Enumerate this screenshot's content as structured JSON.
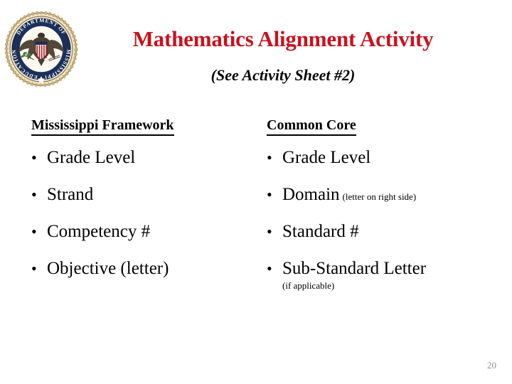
{
  "slide": {
    "title": "Mathematics Alignment Activity",
    "title_color": "#C9121C",
    "subtitle": "(See Activity Sheet #2)",
    "page_number": "20",
    "background_color": "#FFFFFF"
  },
  "logo": {
    "name": "mississippi-department-of-education-seal",
    "ring_text_top": "DEPARTMENT OF",
    "ring_text_bottom": "MISSISSIPPI EDUCATION",
    "ring_color": "#1B2F59",
    "rope_color": "#C9B07A",
    "shield_color": "#B02028"
  },
  "columns": [
    {
      "id": "mississippi-framework",
      "heading": "Mississippi Framework",
      "items": [
        {
          "text": "Grade Level",
          "note": "",
          "note_position": "none"
        },
        {
          "text": "Strand",
          "note": "",
          "note_position": "none"
        },
        {
          "text": "Competency #",
          "note": "",
          "note_position": "none"
        },
        {
          "text": "Objective (letter)",
          "note": "",
          "note_position": "none"
        }
      ]
    },
    {
      "id": "common-core",
      "heading": "Common Core",
      "items": [
        {
          "text": "Grade Level",
          "note": "",
          "note_position": "none"
        },
        {
          "text": "Domain",
          "note": "(letter on right side)",
          "note_position": "inline"
        },
        {
          "text": "Standard #",
          "note": "",
          "note_position": "none"
        },
        {
          "text": "Sub-Standard Letter",
          "note": "(if applicable)",
          "note_position": "below"
        }
      ]
    }
  ],
  "bullet_glyph": "•"
}
